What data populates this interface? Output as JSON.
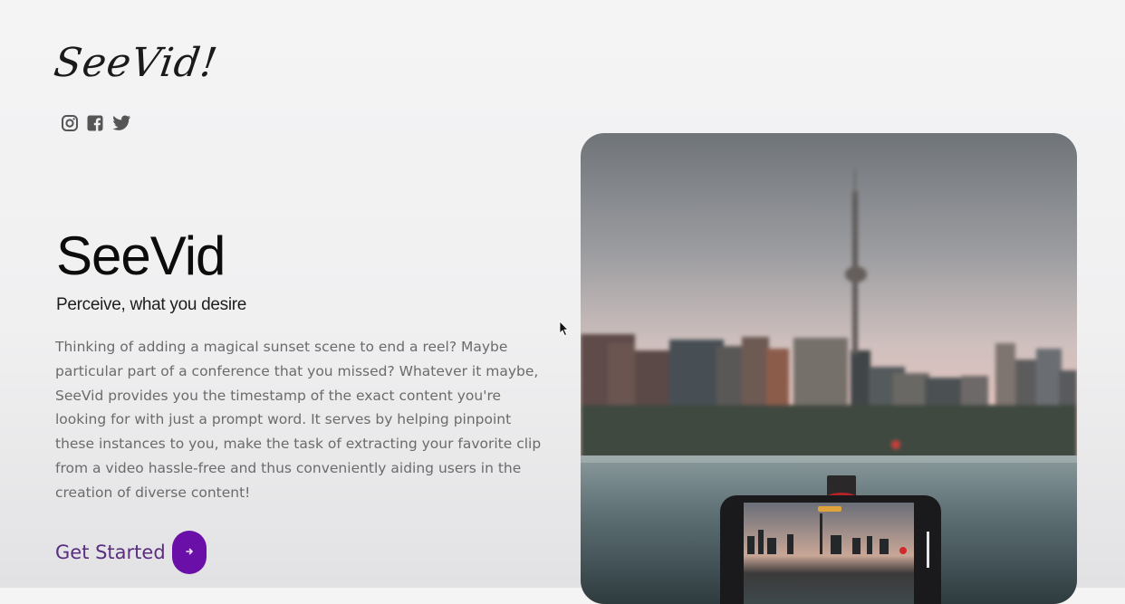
{
  "brand": {
    "logo_text": "SeeVid!"
  },
  "socials": [
    {
      "icon": "instagram-icon"
    },
    {
      "icon": "facebook-icon"
    },
    {
      "icon": "twitter-icon"
    }
  ],
  "hero": {
    "title": "SeeVid",
    "tagline": "Perceive, what you desire",
    "description": "Thinking of adding a magical sunset scene to end a reel? Maybe particular part of a conference that you missed? Whatever it maybe, SeeVid provides you the timestamp of the exact content you're looking for with just a prompt word. It serves by helping pinpoint these instances to you, make the task of extracting your favorite clip from a video hassle-free and thus conveniently aiding users in the creation of diverse content!",
    "cta_label": "Get Started",
    "cta_icon": "arrow-right-icon",
    "image_icon": "city-skyline-phone-photo"
  },
  "colors": {
    "accent": "#6a0fa8",
    "cta_text": "#5a2d80",
    "body_text": "#6b6b6b"
  }
}
